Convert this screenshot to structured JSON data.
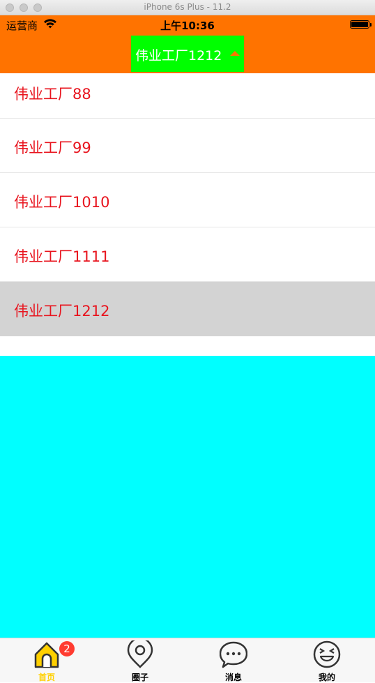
{
  "simulator": {
    "title": "iPhone 6s Plus - 11.2"
  },
  "status_bar": {
    "carrier": "运营商",
    "time": "上午10:36"
  },
  "nav": {
    "picker_label": "伟业工厂1212",
    "picker_expanded": true
  },
  "list": {
    "items": [
      {
        "label": "伟业工厂88"
      },
      {
        "label": "伟业工厂99"
      },
      {
        "label": "伟业工厂1010"
      },
      {
        "label": "伟业工厂1111"
      },
      {
        "label": "伟业工厂1212",
        "selected": true
      }
    ]
  },
  "tabbar": {
    "tabs": [
      {
        "label": "首页",
        "icon": "home-icon",
        "active": true,
        "badge": "2"
      },
      {
        "label": "圈子",
        "icon": "location-pin-icon",
        "active": false
      },
      {
        "label": "消息",
        "icon": "chat-bubble-icon",
        "active": false
      },
      {
        "label": "我的",
        "icon": "face-icon",
        "active": false
      }
    ]
  },
  "colors": {
    "header": "#ff7300",
    "picker": "#00ff00",
    "item_text": "#e8141e",
    "selected_row": "#d3d3d3",
    "content": "#00ffff",
    "active_tab": "#ffd000",
    "badge": "#ff3b30"
  }
}
